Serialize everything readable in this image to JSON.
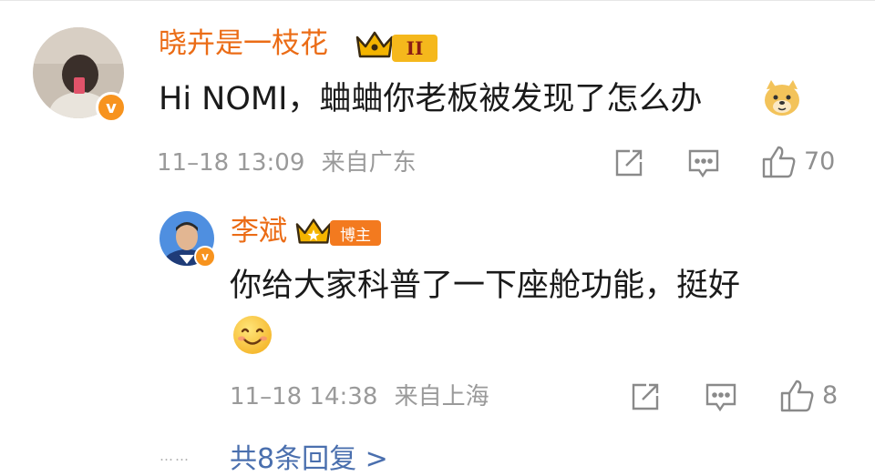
{
  "comment": {
    "user_name": "晓卉是一枝花",
    "level_badge": "II",
    "text": "Hi NOMI，蛐蛐你老板被发现了怎么办",
    "emoji_icon": "doge-emoji-icon",
    "date": "11–18 13:09",
    "location": "来自广东",
    "like_count": "70"
  },
  "reply": {
    "user_name": "李斌",
    "tag": "博主",
    "text": "你给大家科普了一下座舱功能，挺好",
    "emoji_icon": "smile-emoji-icon",
    "date": "11–18 14:38",
    "location": "来自上海",
    "like_count": "8"
  },
  "more_replies": {
    "dots": "……",
    "label": "共8条回复 >"
  },
  "colors": {
    "name": "#eb6c16",
    "verified": "#f7931e",
    "link": "#4a6fae",
    "meta": "#9a9a9a",
    "icon": "#8a8a8a"
  }
}
